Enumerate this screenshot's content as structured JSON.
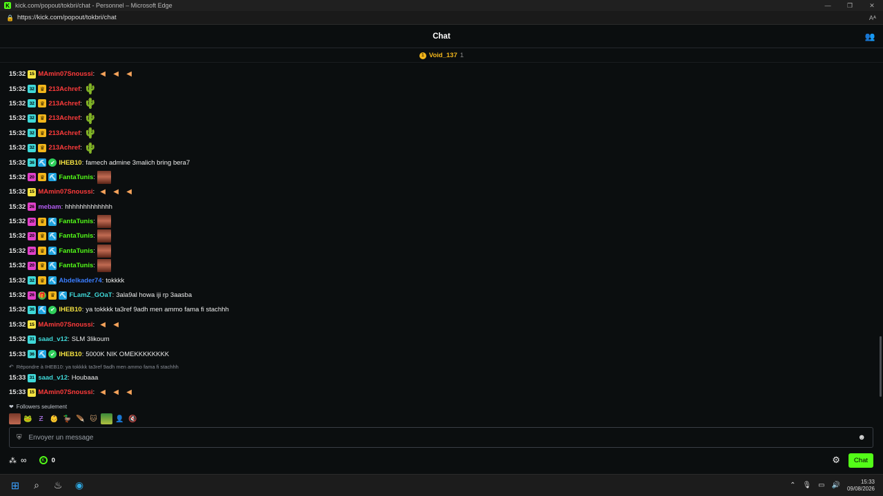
{
  "browser": {
    "window_title": "kick.com/popout/tokbri/chat - Personnel – Microsoft Edge",
    "url": "https://kick.com/popout/tokbri/chat"
  },
  "header": {
    "title": "Chat"
  },
  "pinned": {
    "name": "Void_137",
    "count": "1"
  },
  "messages": [
    {
      "time": "15:32",
      "sub": "15",
      "sub_color": "#f5e341",
      "badges": [],
      "user": "MAmin07Snoussi",
      "color": "#ff3b3b",
      "emotes": "slice3",
      "text": ""
    },
    {
      "time": "15:32",
      "sub": "32",
      "sub_color": "#3fd8d8",
      "badges": [
        "crown"
      ],
      "user": "213Achref",
      "color": "#ff3b3b",
      "emotes": "cactus",
      "text": ""
    },
    {
      "time": "15:32",
      "sub": "32",
      "sub_color": "#3fd8d8",
      "badges": [
        "crown"
      ],
      "user": "213Achref",
      "color": "#ff3b3b",
      "emotes": "cactus",
      "text": ""
    },
    {
      "time": "15:32",
      "sub": "32",
      "sub_color": "#3fd8d8",
      "badges": [
        "crown"
      ],
      "user": "213Achref",
      "color": "#ff3b3b",
      "emotes": "cactus",
      "text": ""
    },
    {
      "time": "15:32",
      "sub": "32",
      "sub_color": "#3fd8d8",
      "badges": [
        "crown"
      ],
      "user": "213Achref",
      "color": "#ff3b3b",
      "emotes": "cactus",
      "text": ""
    },
    {
      "time": "15:32",
      "sub": "32",
      "sub_color": "#3fd8d8",
      "badges": [
        "crown"
      ],
      "user": "213Achref",
      "color": "#ff3b3b",
      "emotes": "cactus",
      "text": ""
    },
    {
      "time": "15:32",
      "sub": "36",
      "sub_color": "#3fd8d8",
      "badges": [
        "pick",
        "verified"
      ],
      "user": "IHEB10",
      "color": "#f5e341",
      "emotes": "",
      "text": "famech admine 3malich bring bera7"
    },
    {
      "time": "15:32",
      "sub": "20",
      "sub_color": "#e040c8",
      "badges": [
        "crown",
        "pick"
      ],
      "user": "FantaTunis",
      "color": "#53fc18",
      "emotes": "face",
      "text": ""
    },
    {
      "time": "15:32",
      "sub": "15",
      "sub_color": "#f5e341",
      "badges": [],
      "user": "MAmin07Snoussi",
      "color": "#ff3b3b",
      "emotes": "slice3",
      "text": ""
    },
    {
      "time": "15:32",
      "sub": "26",
      "sub_color": "#e040c8",
      "badges": [],
      "user": "mebam",
      "color": "#b25cf0",
      "emotes": "",
      "text": "hhhhhhhhhhhhh"
    },
    {
      "time": "15:32",
      "sub": "20",
      "sub_color": "#e040c8",
      "badges": [
        "crown",
        "pick"
      ],
      "user": "FantaTunis",
      "color": "#53fc18",
      "emotes": "face",
      "text": ""
    },
    {
      "time": "15:32",
      "sub": "20",
      "sub_color": "#e040c8",
      "badges": [
        "crown",
        "pick"
      ],
      "user": "FantaTunis",
      "color": "#53fc18",
      "emotes": "face",
      "text": ""
    },
    {
      "time": "15:32",
      "sub": "20",
      "sub_color": "#e040c8",
      "badges": [
        "crown",
        "pick"
      ],
      "user": "FantaTunis",
      "color": "#53fc18",
      "emotes": "face",
      "text": ""
    },
    {
      "time": "15:32",
      "sub": "20",
      "sub_color": "#e040c8",
      "badges": [
        "crown",
        "pick"
      ],
      "user": "FantaTunis",
      "color": "#53fc18",
      "emotes": "face",
      "text": ""
    },
    {
      "time": "15:32",
      "sub": "32",
      "sub_color": "#3fd8d8",
      "badges": [
        "crown",
        "pick"
      ],
      "user": "Abdelkader74",
      "color": "#3a7dff",
      "emotes": "",
      "text": "tokkkk"
    },
    {
      "time": "15:32",
      "sub": "26",
      "sub_color": "#e040c8",
      "badges": [
        "gift",
        "crown",
        "pick"
      ],
      "user": "FLamZ_GOaT",
      "color": "#3fd8d8",
      "emotes": "",
      "text": "3ala9al howa iji rp 3aasba"
    },
    {
      "time": "15:32",
      "sub": "36",
      "sub_color": "#3fd8d8",
      "badges": [
        "pick",
        "verified"
      ],
      "user": "IHEB10",
      "color": "#f5e341",
      "emotes": "",
      "text": "ya tokkkk ta3ref 9adh men ammo fama fi stachhh"
    },
    {
      "time": "15:32",
      "sub": "15",
      "sub_color": "#f5e341",
      "badges": [],
      "user": "MAmin07Snoussi",
      "color": "#ff3b3b",
      "emotes": "slice2",
      "text": ""
    },
    {
      "time": "15:32",
      "sub": "31",
      "sub_color": "#3fd8d8",
      "badges": [],
      "user": "saad_v12",
      "color": "#3fd8d8",
      "emotes": "",
      "text": "SLM 3likoum"
    },
    {
      "time": "15:33",
      "sub": "36",
      "sub_color": "#3fd8d8",
      "badges": [
        "pick",
        "verified"
      ],
      "user": "IHEB10",
      "color": "#f5e341",
      "emotes": "",
      "text": "5000K NIK OMEKKKKKKKK"
    }
  ],
  "reply_hint": "Répondre à IHEB10: ya tokkkk ta3ref 9adh men ammo fama fi stachhh",
  "messages_after": [
    {
      "time": "15:33",
      "sub": "31",
      "sub_color": "#3fd8d8",
      "badges": [],
      "user": "saad_v12",
      "color": "#3fd8d8",
      "emotes": "",
      "text": "Houbaaa"
    },
    {
      "time": "15:33",
      "sub": "15",
      "sub_color": "#f5e341",
      "badges": [],
      "user": "MAmin07Snoussi",
      "color": "#ff3b3b",
      "emotes": "slice3",
      "text": ""
    }
  ],
  "footer": {
    "followers_only": "Followers seulement",
    "input_placeholder": "Envoyer un message",
    "points": "0",
    "chat_button": "Chat",
    "infinity": "∞"
  },
  "taskbar": {
    "time": "15:33",
    "date": "09/08/2026"
  },
  "colors": {
    "accent": "#53fc18",
    "background": "#0b0e0f"
  }
}
